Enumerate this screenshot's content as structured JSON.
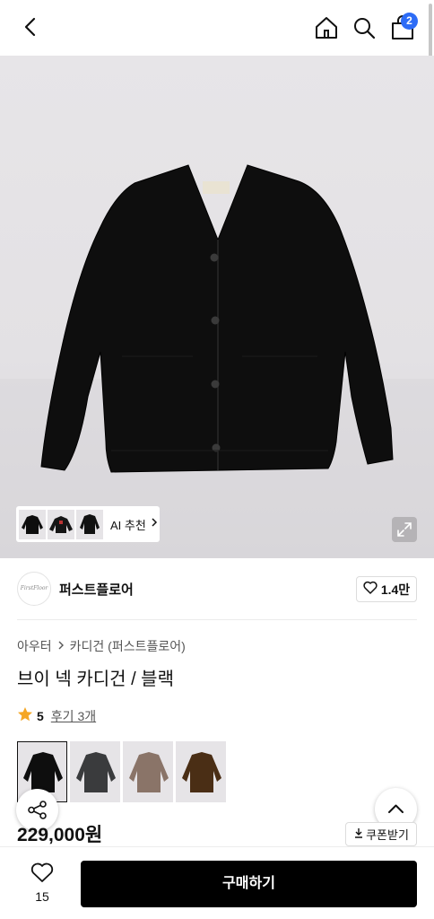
{
  "header": {
    "cart_badge": "2"
  },
  "gallery": {
    "ai_recommend_label": "AI 추천",
    "garment_color": "#0e0e0e"
  },
  "brand": {
    "logo_text": "FirstFloor",
    "name": "퍼스트플로어",
    "like_count": "1.4만"
  },
  "breadcrumb": {
    "items": [
      "아우터",
      "카디건 (퍼스트플로어)"
    ]
  },
  "product": {
    "title": "브이 넥 카디건 / 블랙",
    "rating": "5",
    "reviews_label": "후기 3개",
    "price": "229,000원",
    "coupon_label": "쿠폰받기",
    "swatch_colors": [
      "#0e0e0e",
      "#3a3b3d",
      "#8a7468",
      "#4a2e15"
    ]
  },
  "bottom_bar": {
    "wish_count": "15",
    "buy_label": "구매하기"
  },
  "colors": {
    "accent_badge": "#2d6cf6",
    "star": "#f5a623",
    "buy_button": "#000000"
  }
}
